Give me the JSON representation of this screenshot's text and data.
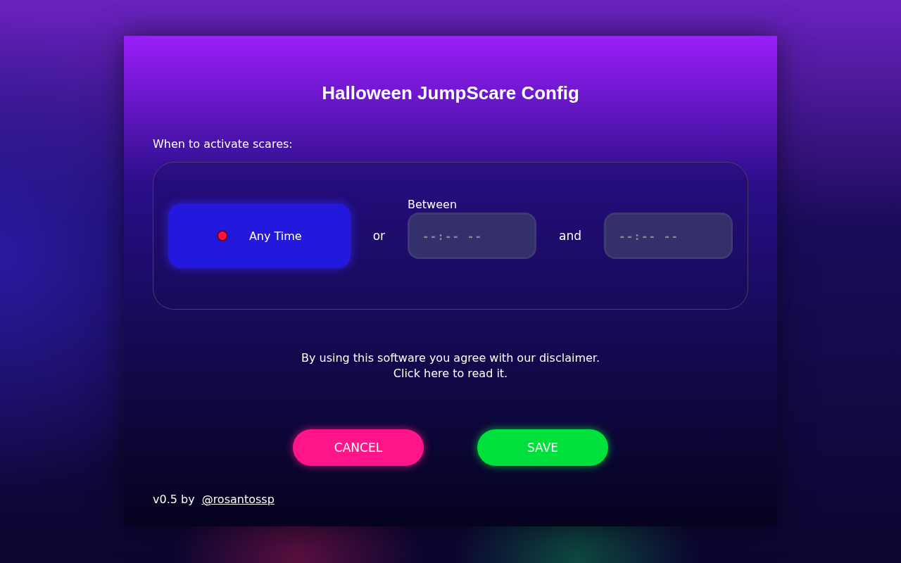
{
  "title": "Halloween JumpScare Config",
  "schedule": {
    "label": "When to activate scares:",
    "any_time": {
      "label": "Any Time",
      "selected": true
    },
    "separator": "or",
    "between_label": "Between",
    "start": {
      "placeholder": "--:-- --"
    },
    "joiner": "and",
    "end": {
      "placeholder": "--:-- --"
    }
  },
  "disclaimer": {
    "text": "By using this software you agree with our disclaimer.",
    "link": "Click here to read it."
  },
  "buttons": [
    {
      "label": "CANCEL",
      "kind": "cancel"
    },
    {
      "label": "SAVE",
      "kind": "save"
    }
  ],
  "footer": {
    "version": "v0.5 by",
    "author": "@rosantossp"
  }
}
